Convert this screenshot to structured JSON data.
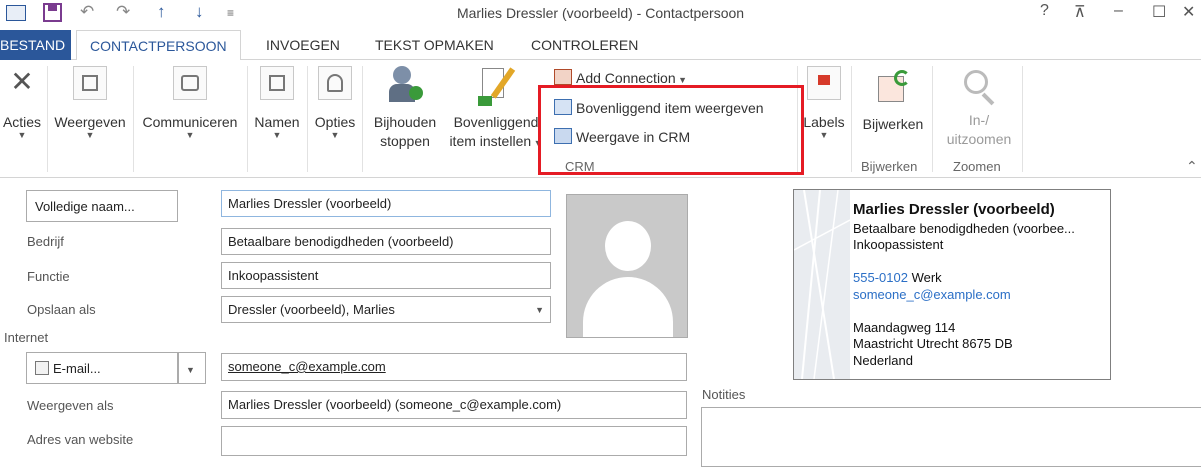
{
  "window": {
    "title": "Marlies Dressler (voorbeeld) - Contactpersoon",
    "help": "?",
    "restore": "⊼",
    "minimize": "–",
    "maximize": "☐",
    "close": "✕"
  },
  "quick_access": {
    "undo": "↶",
    "redo": "↷",
    "up": "↑",
    "down": "↓",
    "customize": "≡"
  },
  "tabs": [
    {
      "label": "BESTAND"
    },
    {
      "label": "CONTACTPERSOON"
    },
    {
      "label": "INVOEGEN"
    },
    {
      "label": "TEKST OPMAKEN"
    },
    {
      "label": "CONTROLEREN"
    }
  ],
  "ribbon": {
    "acties": "Acties",
    "weergeven": "Weergeven",
    "communiceren": "Communiceren",
    "namen": "Namen",
    "opties": "Opties",
    "bijhouden_1": "Bijhouden",
    "bijhouden_2": "stoppen",
    "bovenliggend_1": "Bovenliggend",
    "bovenliggend_2": "item instellen",
    "add_connection": "Add Connection",
    "bovenliggend_weergeven": "Bovenliggend item weergeven",
    "weergave_crm": "Weergave in CRM",
    "crm_group": "CRM",
    "labels": "Labels",
    "bijwerken": "Bijwerken",
    "bijwerken_group": "Bijwerken",
    "inzoomen_1": "In-/",
    "inzoomen_2": "uitzoomen",
    "zoomen_group": "Zoomen",
    "collapse": "⌃"
  },
  "form": {
    "volledige_naam_button": "Volledige naam...",
    "volledige_naam_value": "Marlies Dressler (voorbeeld)",
    "bedrijf_label": "Bedrijf",
    "bedrijf_value": "Betaalbare benodigdheden (voorbeeld)",
    "functie_label": "Functie",
    "functie_value": "Inkoopassistent",
    "opslaan_label": "Opslaan als",
    "opslaan_value": "Dressler (voorbeeld), Marlies",
    "internet_label": "Internet",
    "email_button": "E-mail...",
    "email_value": "someone_c@example.com",
    "weergeven_label": "Weergeven als",
    "weergeven_value": "Marlies Dressler (voorbeeld) (someone_c@example.com)",
    "website_label": "Adres van website",
    "notities_label": "Notities"
  },
  "card": {
    "name": "Marlies Dressler (voorbeeld)",
    "company": "Betaalbare benodigdheden (voorbee...",
    "title": "Inkoopassistent",
    "phone": "555-0102",
    "phone_type": "Werk",
    "email": "someone_c@example.com",
    "street": "Maandagweg 114",
    "city": "Maastricht  Utrecht  8675 DB",
    "country": "Nederland"
  }
}
